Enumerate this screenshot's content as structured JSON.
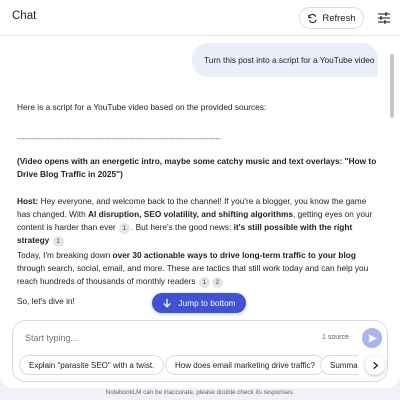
{
  "header": {
    "title": "Chat",
    "refresh_label": "Refresh"
  },
  "user_message": "Turn this post into a script for a YouTube video",
  "reply": {
    "intro": "Here is a script for a YouTube video based on the provided sources:",
    "divider": "--------------------------------------------------------------------------------------",
    "stage_direction": "(Video opens with an energetic intro, maybe some catchy music and text overlays: \"How to Drive Blog Traffic in 2025\")",
    "host_label": "Host:",
    "host_1": " Hey everyone, and welcome back to the channel! If you're a blogger, you know the game has changed. With ",
    "host_bold_1": "AI disruption, SEO volatility, and shifting algorithms",
    "host_2": ", getting eyes on your content is harder than ever ",
    "host_3": ". But here's the good news: ",
    "host_bold_2": "it's still possible with the right strategy",
    "cite_1": "1",
    "cite_2": "1",
    "p2_1": "Today, I'm breaking down ",
    "p2_bold": "over 30 actionable ways to drive long-term traffic to your blog",
    "p2_2": " through search, social, email, and more. These are tactics that still work today and can help you reach hundreds of thousands of monthly readers ",
    "cite_3": "1",
    "cite_4": "2",
    "p3": "So, let's dive in!"
  },
  "jump_label": "Jump to bottom",
  "composer": {
    "placeholder": "Start typing...",
    "source_count": "1 source"
  },
  "suggestions": [
    "Explain \"parasite SEO\" with a twist.",
    "How does email marketing drive traffic?",
    "Summar"
  ],
  "footer": "NotebookLM can be inaccurate, please double check its responses.",
  "colors": {
    "accent": "#3f51d6",
    "send_button": "#a8b5f0",
    "user_bubble": "#e9eef8"
  }
}
